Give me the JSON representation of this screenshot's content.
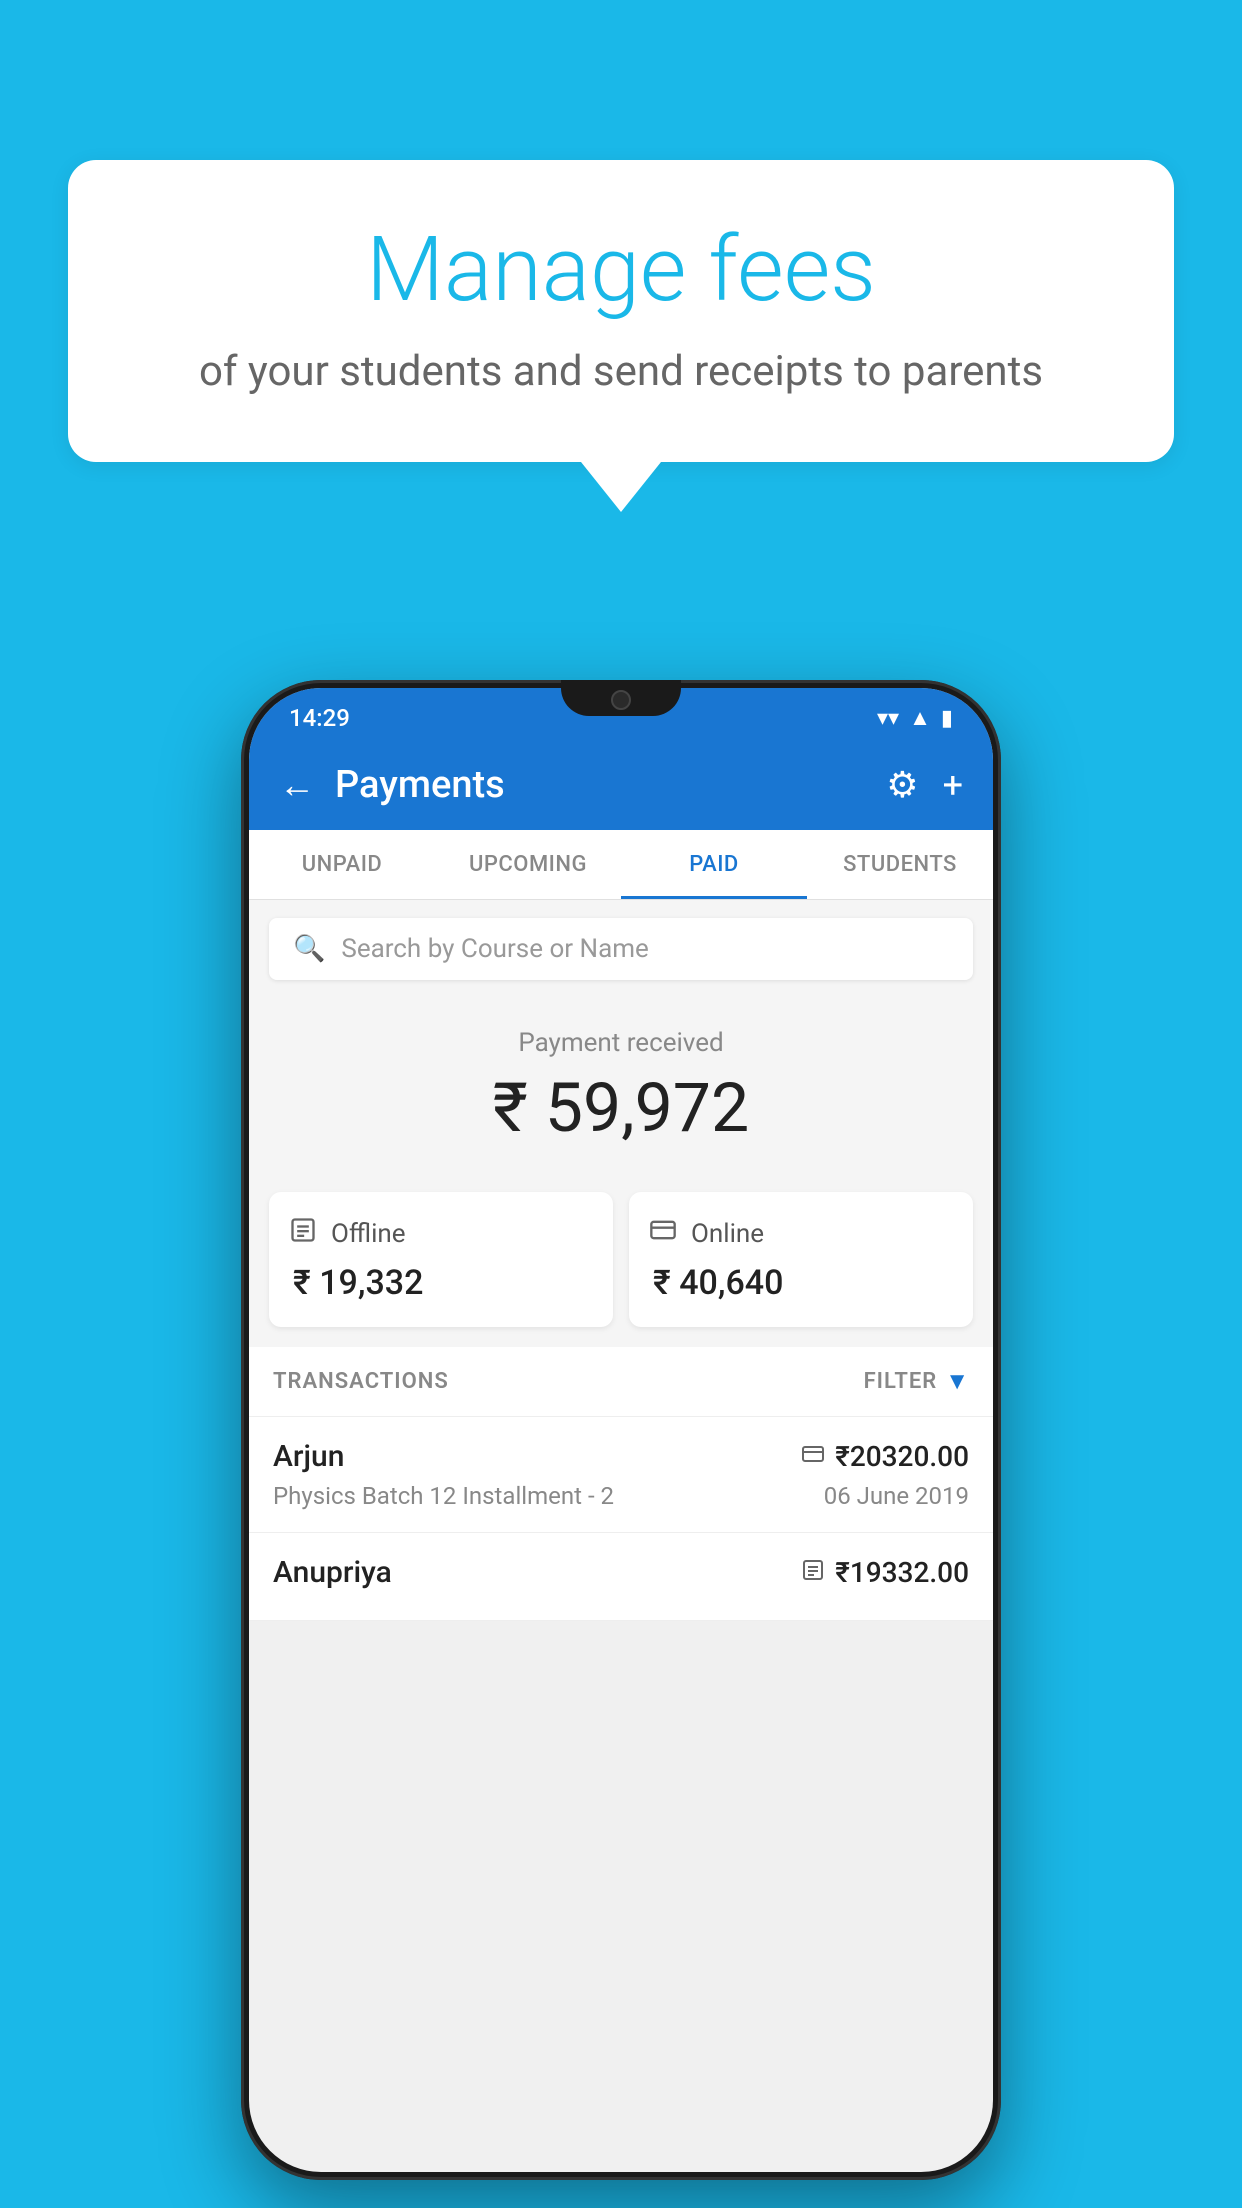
{
  "background_color": "#1ab8e8",
  "speech_bubble": {
    "title": "Manage fees",
    "subtitle": "of your students and send receipts to parents"
  },
  "status_bar": {
    "time": "14:29",
    "wifi_icon": "▾",
    "signal_icon": "▲",
    "battery_icon": "▮"
  },
  "header": {
    "title": "Payments",
    "back_icon": "←",
    "settings_icon": "⚙",
    "add_icon": "+"
  },
  "tabs": [
    {
      "label": "UNPAID",
      "active": false
    },
    {
      "label": "UPCOMING",
      "active": false
    },
    {
      "label": "PAID",
      "active": true
    },
    {
      "label": "STUDENTS",
      "active": false
    }
  ],
  "search": {
    "placeholder": "Search by Course or Name",
    "icon": "🔍"
  },
  "payment_summary": {
    "label": "Payment received",
    "amount": "₹ 59,972",
    "offline": {
      "label": "Offline",
      "amount": "₹ 19,332",
      "icon": "💳"
    },
    "online": {
      "label": "Online",
      "amount": "₹ 40,640",
      "icon": "💳"
    }
  },
  "transactions_section": {
    "label": "TRANSACTIONS",
    "filter_label": "FILTER",
    "rows": [
      {
        "name": "Arjun",
        "course": "Physics Batch 12 Installment - 2",
        "amount": "₹20320.00",
        "date": "06 June 2019",
        "type_icon": "💳"
      },
      {
        "name": "Anupriya",
        "course": "",
        "amount": "₹19332.00",
        "date": "",
        "type_icon": "💴"
      }
    ]
  }
}
